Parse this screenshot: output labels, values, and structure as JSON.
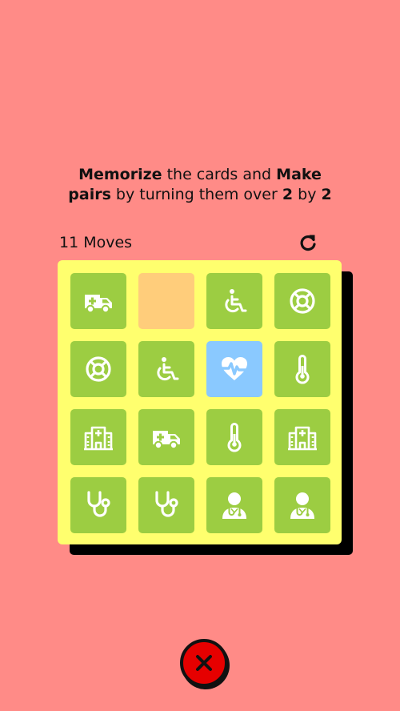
{
  "instructions": {
    "w1": "Memorize",
    "w2": " the cards and ",
    "w3": "Make",
    "w4": "pairs",
    "w5": " by turning them over ",
    "w6": "2",
    "w7": " by ",
    "w8": "2"
  },
  "moves": "11 Moves",
  "colors": {
    "background": "#ff8b87",
    "board": "#ffff6e",
    "card": "#9ccd42",
    "card_hidden": "#ffcd7b",
    "card_flipped": "#8ac9ff",
    "close": "#e60000"
  },
  "cards": [
    {
      "icon": "ambulance-icon",
      "state": "matched"
    },
    {
      "icon": "",
      "state": "hidden"
    },
    {
      "icon": "wheelchair-icon",
      "state": "matched"
    },
    {
      "icon": "lifebuoy-icon",
      "state": "matched"
    },
    {
      "icon": "lifebuoy-icon",
      "state": "matched"
    },
    {
      "icon": "wheelchair-icon",
      "state": "matched"
    },
    {
      "icon": "heartbeat-icon",
      "state": "flipped"
    },
    {
      "icon": "thermometer-icon",
      "state": "matched"
    },
    {
      "icon": "hospital-icon",
      "state": "matched"
    },
    {
      "icon": "ambulance-icon",
      "state": "matched"
    },
    {
      "icon": "thermometer-icon",
      "state": "matched"
    },
    {
      "icon": "hospital-icon",
      "state": "matched"
    },
    {
      "icon": "stethoscope-icon",
      "state": "matched"
    },
    {
      "icon": "stethoscope-icon",
      "state": "matched"
    },
    {
      "icon": "doctor-icon",
      "state": "matched"
    },
    {
      "icon": "doctor-icon",
      "state": "matched"
    }
  ]
}
